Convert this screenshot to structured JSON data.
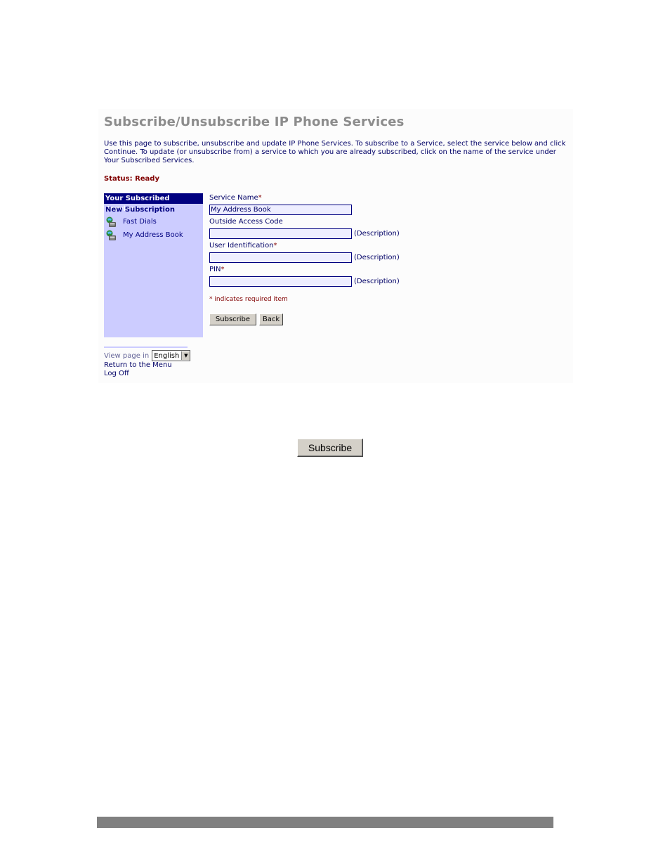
{
  "header": {
    "title": "Subscribe/Unsubscribe IP Phone Services",
    "intro": "Use this page to subscribe, unsubscribe and update IP Phone Services. To subscribe to a Service, select the service below and click Continue. To update (or unsubscribe from) a service to which you are already subscribed, click on the name of the service under Your Subscribed Services.",
    "status": "Status: Ready"
  },
  "sidebar": {
    "header": "Your Subscribed Services",
    "new_subscription": "New Subscription",
    "items": [
      {
        "label": "Fast Dials",
        "icon": "phone-service-icon"
      },
      {
        "label": "My Address Book",
        "icon": "phone-service-icon"
      }
    ]
  },
  "form": {
    "service_name": {
      "label": "Service Name",
      "required_mark": "*",
      "value": "My Address Book"
    },
    "outside_access_code": {
      "label": "Outside Access Code",
      "value": "",
      "desc": "(Description)"
    },
    "user_identification": {
      "label": "User Identification",
      "required_mark": "*",
      "value": "",
      "desc": "(Description)"
    },
    "pin": {
      "label": "PIN",
      "required_mark": "*",
      "value": "",
      "desc": "(Description)"
    },
    "required_note": "* indicates required item",
    "subscribe_label": "Subscribe",
    "back_label": "Back"
  },
  "footer": {
    "view_page_in": "View page in",
    "language": "English",
    "return_menu": "Return to the Menu",
    "log_off": "Log Off"
  },
  "callout": {
    "subscribe_label": "Subscribe"
  },
  "colors": {
    "accent": "#000080",
    "sidebar_bg": "#ccccff",
    "status": "#800000",
    "footer_bar": "#808080"
  }
}
